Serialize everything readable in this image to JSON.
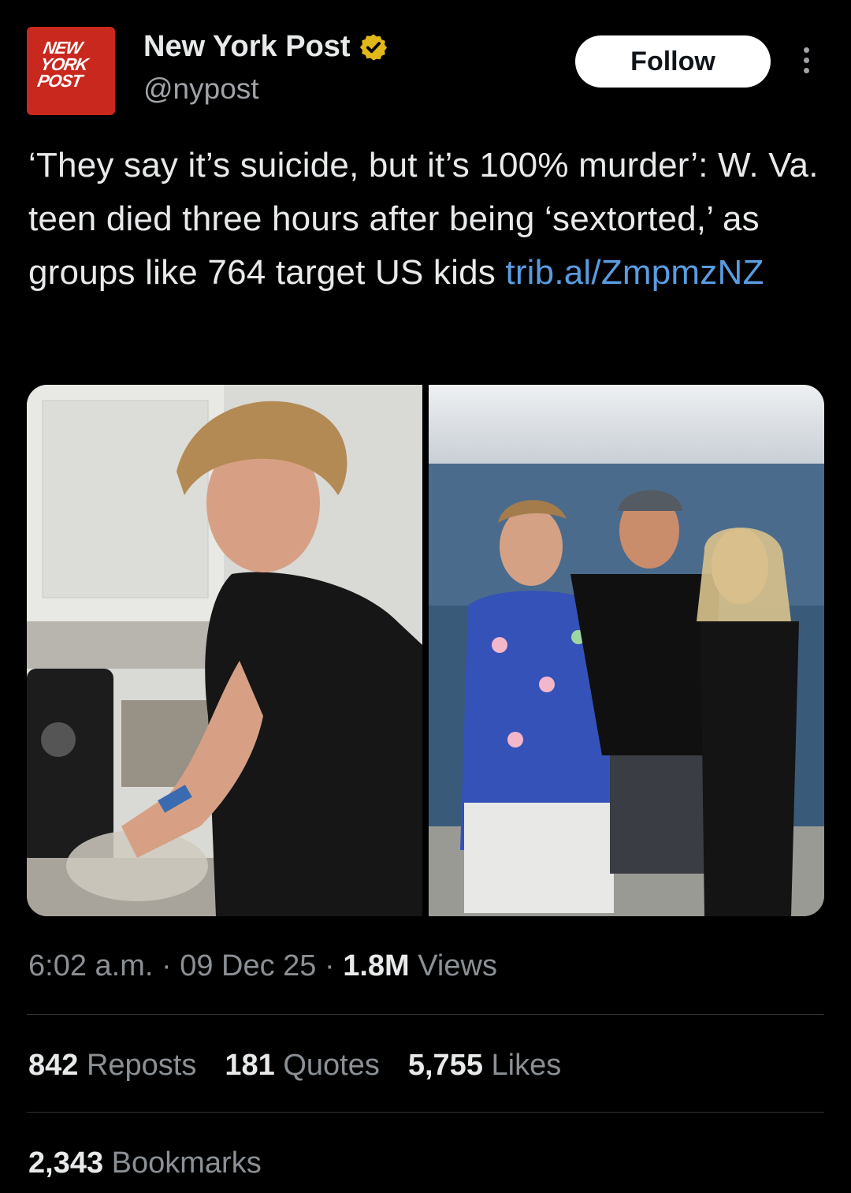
{
  "account": {
    "name": "New York Post",
    "handle": "@nypost",
    "logo_lines": [
      "NEW",
      "YORK",
      "POST"
    ],
    "verified_icon": "verified-badge-icon",
    "brand_color": "#c8281e",
    "badge_color": "#e2b719"
  },
  "actions": {
    "follow_label": "Follow",
    "more_icon": "more-vertical-icon"
  },
  "tweet": {
    "text": "‘They say it’s suicide, but it’s 100% murder’: W. Va. teen died three hours after being ‘sextorted,’ as groups like 764 target US kids ",
    "link": "trib.al/ZmpmzNZ",
    "link_color": "#5a9ce0"
  },
  "meta": {
    "time": "6:02 a.m.",
    "sep1": " · ",
    "date": "09 Dec 25",
    "sep2": " · ",
    "views_count": "1.8M",
    "views_label": " Views"
  },
  "stats": [
    {
      "count": "842",
      "label": " Reposts"
    },
    {
      "count": "181",
      "label": " Quotes"
    },
    {
      "count": "5,755",
      "label": " Likes"
    }
  ],
  "bookmarks": {
    "count": "2,343",
    "label": " Bookmarks"
  }
}
